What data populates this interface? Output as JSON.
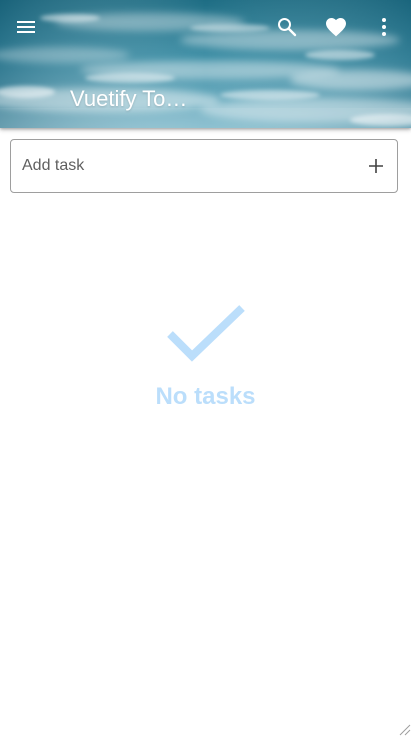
{
  "app_bar": {
    "title": "Vuetify To…",
    "icons": {
      "menu": "menu-icon",
      "search": "search-icon",
      "favorite": "heart-icon",
      "more": "more-vertical-icon"
    }
  },
  "add_task": {
    "placeholder": "Add task",
    "value": "",
    "add_icon": "plus-icon"
  },
  "empty_state": {
    "icon": "check-icon",
    "text": "No tasks"
  },
  "colors": {
    "empty_state_accent": "#bbdefb",
    "app_bar_sky_top": "#1e6d84",
    "app_bar_sky_bottom": "#7fb7c9",
    "field_border": "#9e9e9e"
  }
}
